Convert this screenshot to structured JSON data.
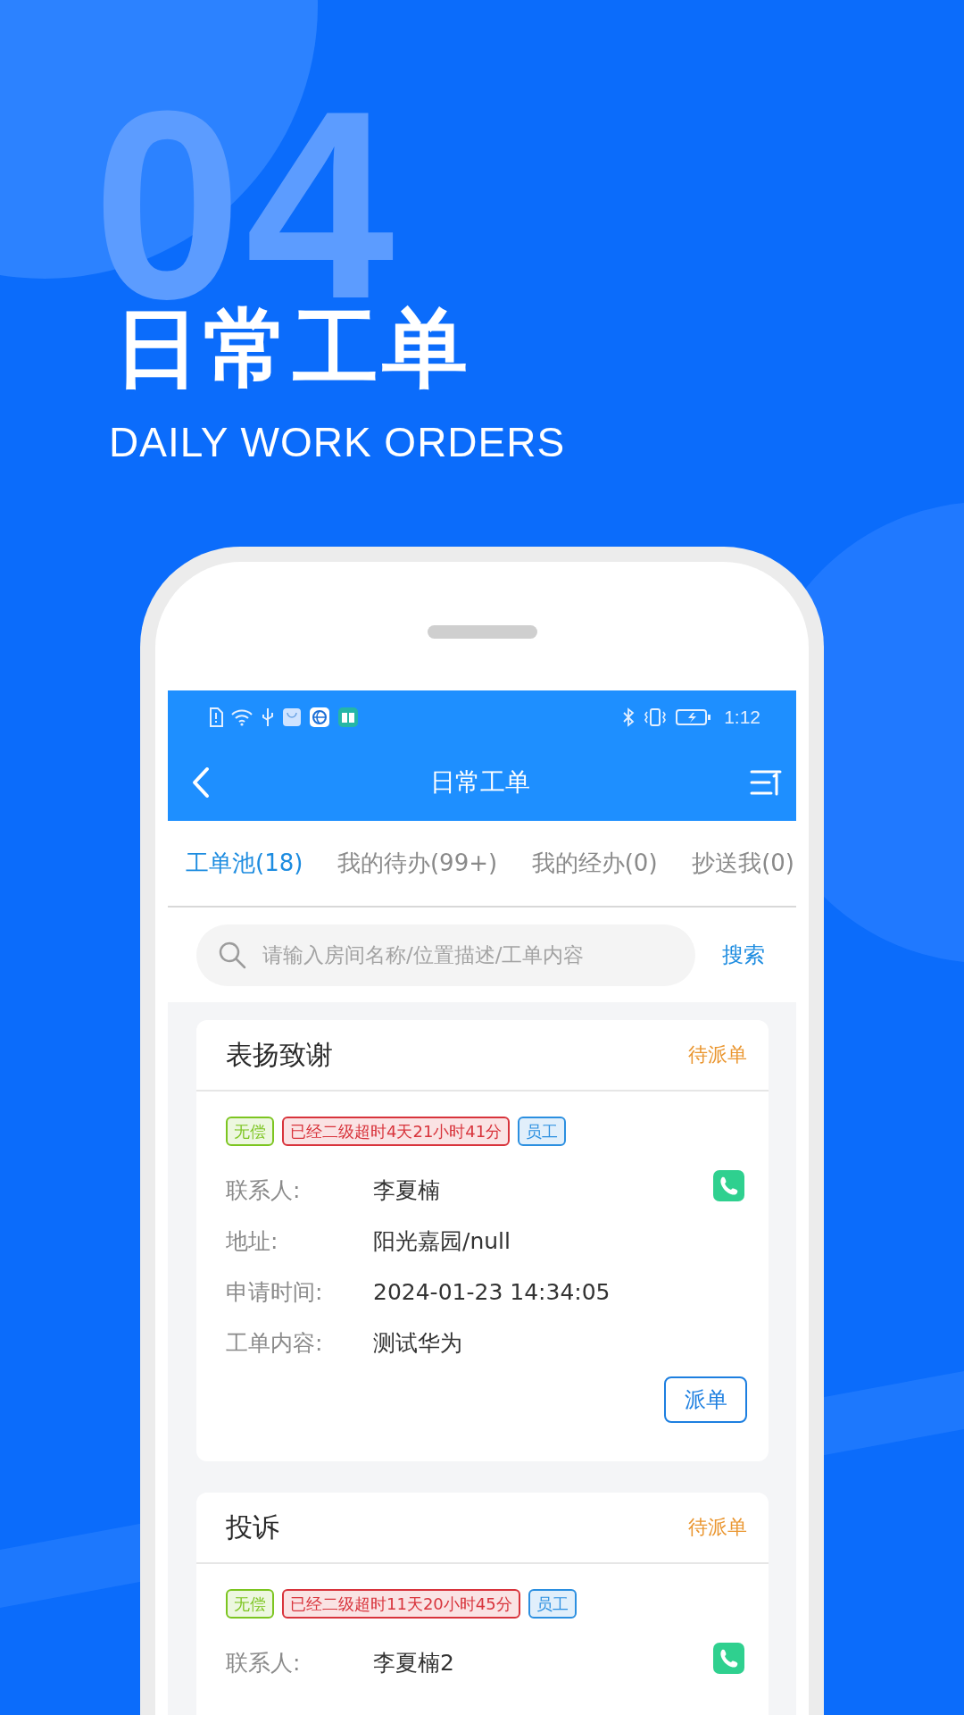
{
  "hero": {
    "number": "04",
    "title": "日常工单",
    "subtitle": "DAILY WORK ORDERS"
  },
  "status_bar": {
    "time": "1:12"
  },
  "nav": {
    "title": "日常工单"
  },
  "tabs": [
    {
      "label": "工单池(18)",
      "selected": true
    },
    {
      "label": "我的待办(99+)",
      "selected": false
    },
    {
      "label": "我的经办(0)",
      "selected": false
    },
    {
      "label": "抄送我(0)",
      "selected": false
    }
  ],
  "search": {
    "placeholder": "请输入房间名称/位置描述/工单内容",
    "button": "搜索"
  },
  "orders": [
    {
      "title": "表扬致谢",
      "status": "待派单",
      "tags": [
        {
          "text": "无偿",
          "color": "#7cc520"
        },
        {
          "text": "已经二级超时4天21小时41分",
          "color": "#d8343c"
        },
        {
          "text": "员工",
          "color": "#2b8fe0"
        }
      ],
      "fields": [
        {
          "label": "联系人:",
          "value": "李夏楠"
        },
        {
          "label": "地址:",
          "value": "阳光嘉园/null"
        },
        {
          "label": "申请时间:",
          "value": "2024-01-23 14:34:05"
        },
        {
          "label": "工单内容:",
          "value": "测试华为"
        }
      ],
      "action": "派单"
    },
    {
      "title": "投诉",
      "status": "待派单",
      "tags": [
        {
          "text": "无偿",
          "color": "#7cc520"
        },
        {
          "text": "已经二级超时11天20小时45分",
          "color": "#d8343c"
        },
        {
          "text": "员工",
          "color": "#2b8fe0"
        }
      ],
      "fields": [
        {
          "label": "联系人:",
          "value": "李夏楠2"
        }
      ]
    }
  ]
}
